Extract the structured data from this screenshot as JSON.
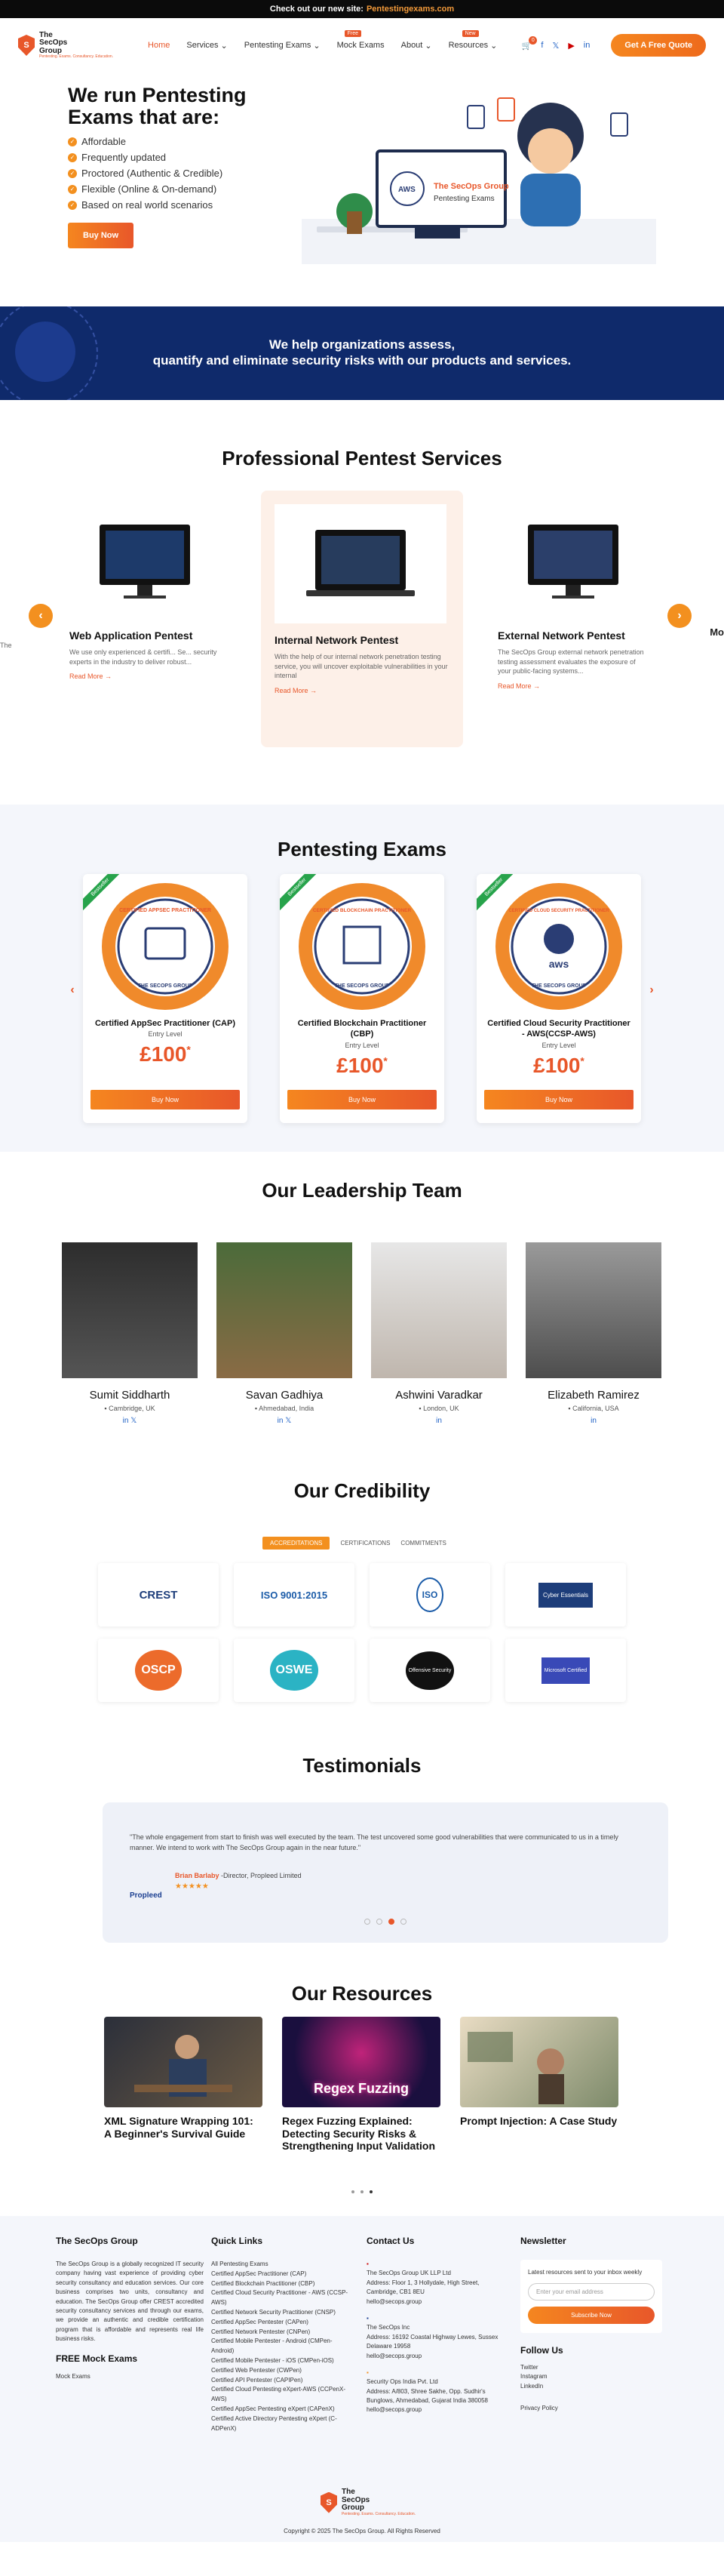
{
  "topbar": {
    "text": "Check out our new site:",
    "link": "Pentestingexams.com"
  },
  "brand": {
    "line1": "The",
    "line2": "SecOps",
    "line3": "Group",
    "tagline": "Pentesting. Exams. Consultancy. Education."
  },
  "nav": {
    "items": [
      "Home",
      "Services",
      "Pentesting Exams",
      "Mock Exams",
      "About",
      "Resources"
    ],
    "mock_badge": "Free",
    "resources_badge": "New",
    "cart_count": "0",
    "quote": "Get A Free Quote"
  },
  "hero": {
    "title": "We run Pentesting Exams that are:",
    "bullets": [
      "Affordable",
      "Frequently updated",
      "Proctored (Authentic & Credible)",
      "Flexible (Online & On-demand)",
      "Based on real world scenarios"
    ],
    "cta": "Buy Now",
    "art_label1": "The SecOps Group",
    "art_label2": "Pentesting Exams",
    "art_aws": "AWS"
  },
  "band": {
    "line1": "We help organizations assess,",
    "line2": "quantify and eliminate security risks with our products and services."
  },
  "services": {
    "title": "Professional Pentest Services",
    "cards": [
      {
        "title": "Web Application Pentest",
        "desc": "We use only experienced & certifi... Se... security experts in the industry to deliver robust...",
        "link": "Read More →"
      },
      {
        "title": "Internal Network Pentest",
        "desc": "With the help of our internal network penetration testing service, you will uncover exploitable vulnerabilities in your internal",
        "link": "Read More →"
      },
      {
        "title": "External Network Pentest",
        "desc": "The SecOps Group external network penetration testing assessment evaluates the exposure of your public-facing systems...",
        "link": "Read More →"
      }
    ],
    "edge_left": "The",
    "edge_right": "Mo"
  },
  "exams": {
    "title": "Pentesting Exams",
    "ribbon": "Bestseller",
    "cards": [
      {
        "seal": "CERTIFIED APPSEC PRACTITIONER",
        "name": "Certified AppSec Practitioner (CAP)",
        "level": "Entry Level",
        "price": "£100",
        "buy": "Buy Now"
      },
      {
        "seal": "CERTIFIED BLOCKCHAIN PRACTITIONER",
        "name": "Certified Blockchain Practitioner (CBP)",
        "level": "Entry Level",
        "price": "£100",
        "buy": "Buy Now"
      },
      {
        "seal": "CERTIFIED CLOUD SECURITY PRACTITIONER",
        "name": "Certified Cloud Security Practitioner - AWS(CCSP-AWS)",
        "level": "Entry Level",
        "price": "£100",
        "buy": "Buy Now"
      }
    ],
    "seal_bottom": "THE SECOPS GROUP",
    "aws": "aws",
    "price_sup": "*"
  },
  "leaders": {
    "title": "Our Leadership Team",
    "people": [
      {
        "name": "Sumit Siddharth",
        "loc": "Cambridge, UK"
      },
      {
        "name": "Savan Gadhiya",
        "loc": "Ahmedabad, India"
      },
      {
        "name": "Ashwini Varadkar",
        "loc": "London, UK"
      },
      {
        "name": "Elizabeth Ramirez",
        "loc": "California, USA"
      }
    ]
  },
  "cred": {
    "title": "Our Credibility",
    "tabs": [
      "ACCREDITATIONS",
      "CERTIFICATIONS",
      "COMMITMENTS"
    ],
    "badges": [
      "CREST",
      "ISO 9001:2015",
      "ISO",
      "Cyber Essentials",
      "OSCP",
      "OSWE",
      "Offensive Security",
      "Microsoft Certified"
    ]
  },
  "testimonials": {
    "title": "Testimonials",
    "quote": "\"The whole engagement from start to finish was well executed by the team. The test uncovered some good vulnerabilities that were communicated to us in a timely manner. We intend to work with The SecOps Group again in the near future.\"",
    "author": "Brian Barlaby",
    "role": "-Director, Propleed Limited",
    "stars": "★★★★★",
    "company": "Propleed"
  },
  "resources": {
    "title": "Our Resources",
    "items": [
      {
        "title": "XML Signature Wrapping 101: A Beginner's Survival Guide"
      },
      {
        "title": "Regex Fuzzing Explained: Detecting Security Risks & Strengthening Input Validation",
        "overlay": "Regex Fuzzing"
      },
      {
        "title": "Prompt Injection: A Case Study"
      }
    ]
  },
  "footer": {
    "about_title": "The SecOps Group",
    "about": "The SecOps Group is a globally recognized IT security company having vast experience of providing cyber security consultancy and education services. Our core business comprises two units, consultancy and education. The SecOps Group offer CREST accredited security consultancy services and through our exams, we provide an authentic and credible certification program that is affordable and represents real life business risks.",
    "mock_title": "FREE Mock Exams",
    "mock_link": "Mock Exams",
    "quick_title": "Quick Links",
    "quick": [
      "All Pentesting Exams",
      "Certified AppSec Practitioner (CAP)",
      "Certified Blockchain Practitioner (CBP)",
      "Certified Cloud Security Practitioner - AWS (CCSP-AWS)",
      "Certified Network Security Practitioner (CNSP)",
      "Certified AppSec Pentester (CAPen)",
      "Certified Network Pentester (CNPen)",
      "Certified Mobile Pentester - Android (CMPen-Android)",
      "Certified Mobile Pentester - iOS (CMPen-iOS)",
      "Certified Web Pentester (CWPen)",
      "Certified API Pentester (CAPIPen)",
      "Certified Cloud Pentesting eXpert-AWS (CCPenX-AWS)",
      "Certified AppSec Pentesting eXpert (CAPenX)",
      "Certified Active Directory Pentesting eXpert (C-ADPenX)"
    ],
    "contact_title": "Contact Us",
    "contacts": [
      {
        "name": "The SecOps Group UK LLP Ltd",
        "addr": "Address: Floor 1, 3 Hollydale, High Street, Cambridge, CB1 8EU",
        "mail": "hello@secops.group"
      },
      {
        "name": "The SecOps Inc",
        "addr": "Address: 16192 Coastal Highway Lewes, Sussex Delaware 19958",
        "mail": "hello@secops.group"
      },
      {
        "name": "Security Ops India Pvt. Ltd",
        "addr": "Address: A/803, Shree Sakhe, Opp. Sudhir's Bunglows, Ahmedabad, Gujarat India 380058",
        "mail": "hello@secops.group"
      }
    ],
    "news_title": "Newsletter",
    "news_text": "Latest resources sent to your inbox weekly",
    "news_placeholder": "Enter your email address",
    "news_btn": "Subscribe Now",
    "follow_title": "Follow Us",
    "follow": [
      "Twitter",
      "Instagram",
      "LinkedIn"
    ],
    "privacy": "Privacy Policy",
    "copyright": "Copyright © 2025 The SecOps Group. All Rights Reserved"
  },
  "colors": {
    "accent": "#e8572a",
    "orange": "#f3901f",
    "navy": "#0f2a6b"
  }
}
